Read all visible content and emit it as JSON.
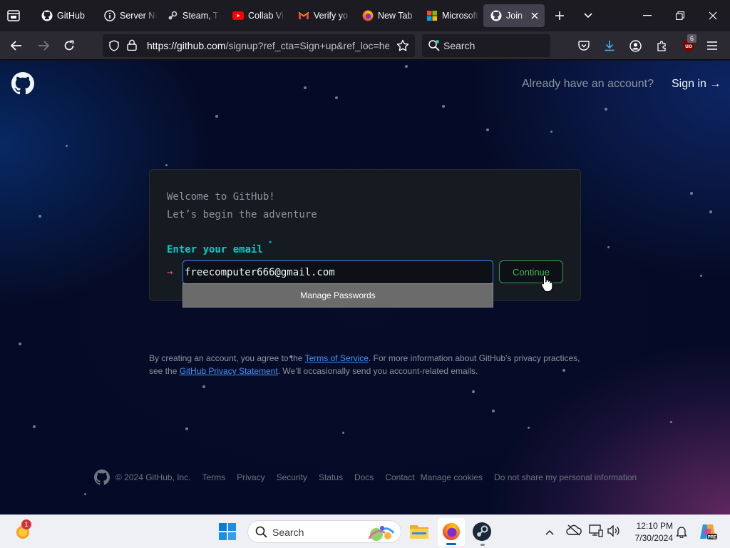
{
  "browser": {
    "tabs": [
      {
        "title": "GitHub",
        "icon": "github-icon"
      },
      {
        "title": "Server Not Found",
        "icon": "info-icon"
      },
      {
        "title": "Steam, T",
        "icon": "steam-icon"
      },
      {
        "title": "Collab Vi",
        "icon": "youtube-icon"
      },
      {
        "title": "Verify yo",
        "icon": "gmail-icon"
      },
      {
        "title": "New Tab",
        "icon": "firefox-icon"
      },
      {
        "title": "Microsoft",
        "icon": "microsoft-icon"
      },
      {
        "title": "Join GitHub",
        "icon": "github-icon",
        "active": true
      }
    ],
    "url_host": "https://github.com",
    "url_rest": "/signup?ref_cta=Sign+up&ref_loc=header+logged+out",
    "search_placeholder": "Search",
    "extension_badge": "6"
  },
  "page": {
    "header": {
      "already_text": "Already have an account?",
      "sign_in": "Sign in →"
    },
    "card": {
      "welcome_line1": "Welcome to GitHub!",
      "welcome_line2": "Let’s begin the adventure",
      "email_label": "Enter your email",
      "required_mark": "*",
      "arrow": "→",
      "email_value": "freecomputer666@gmail.com",
      "continue_label": "Continue"
    },
    "autocomplete": {
      "manage_passwords": "Manage Passwords"
    },
    "terms": {
      "p1": "By creating an account, you agree to the ",
      "tos_link": "Terms of Service",
      "p2": ". For more information about GitHub’s privacy practices, see the ",
      "privacy_link": "GitHub Privacy Statement",
      "p3": ". We’ll occasionally send you account-related emails."
    },
    "footer": {
      "copyright": "© 2024 GitHub, Inc.",
      "links": [
        "Terms",
        "Privacy",
        "Security",
        "Status",
        "Docs",
        "Contact",
        "Manage cookies",
        "Do not share my personal information"
      ]
    }
  },
  "taskbar": {
    "search_label": "Search",
    "weather_badge": "1",
    "time": "12:10 PM",
    "date": "7/30/2024"
  },
  "colors": {
    "accent_blue": "#2f81f7",
    "continue_green": "#3fb950",
    "label_cyan": "#00cfc8",
    "arrow_pink": "#ea4aaa"
  }
}
